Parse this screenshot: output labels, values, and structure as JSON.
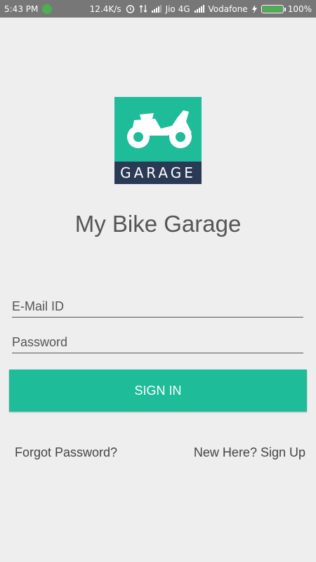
{
  "status_bar": {
    "time": "5:43 PM",
    "network_speed": "12.4K/s",
    "carrier1": "Jio 4G",
    "carrier2": "Vodafone",
    "battery": "100%"
  },
  "logo": {
    "text": "GARAGE",
    "icon": "motorcycle-icon"
  },
  "app_title": "My Bike Garage",
  "form": {
    "email_placeholder": "E-Mail ID",
    "password_placeholder": "Password",
    "signin_label": "SIGN IN"
  },
  "links": {
    "forgot": "Forgot Password?",
    "signup": "New Here? Sign Up"
  },
  "colors": {
    "accent": "#1fbc9a",
    "logo_band": "#2a3a55",
    "background": "#eeeeee",
    "statusbar": "#777777"
  }
}
